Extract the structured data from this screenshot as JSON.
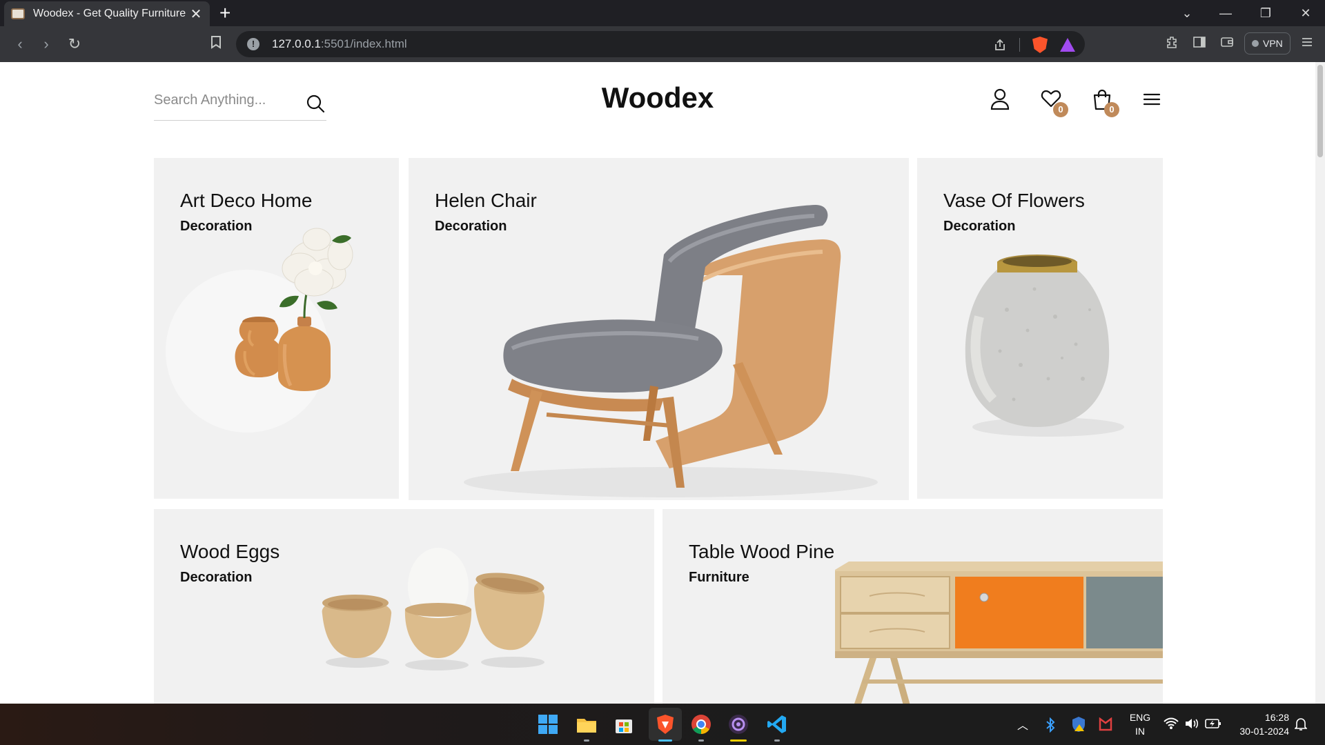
{
  "browser": {
    "tab_title": "Woodex - Get Quality Furniture",
    "url_host": "127.0.0.1",
    "url_rest": ":5501/index.html",
    "vpn_label": "VPN"
  },
  "header": {
    "search_placeholder": "Search Anything...",
    "logo": "Woodex",
    "wishlist_count": "0",
    "cart_count": "0"
  },
  "products": [
    {
      "title": "Art Deco Home",
      "category": "Decoration"
    },
    {
      "title": "Helen Chair",
      "category": "Decoration"
    },
    {
      "title": "Vase Of Flowers",
      "category": "Decoration"
    },
    {
      "title": "Wood Eggs",
      "category": "Decoration"
    },
    {
      "title": "Table Wood Pine",
      "category": "Furniture"
    }
  ],
  "taskbar": {
    "lang_line1": "ENG",
    "lang_line2": "IN",
    "time": "16:28",
    "date": "30-01-2024"
  },
  "colors": {
    "accent_badge": "#c08a5a",
    "card_bg": "#f1f1f1",
    "browser_bg": "#35363a"
  }
}
